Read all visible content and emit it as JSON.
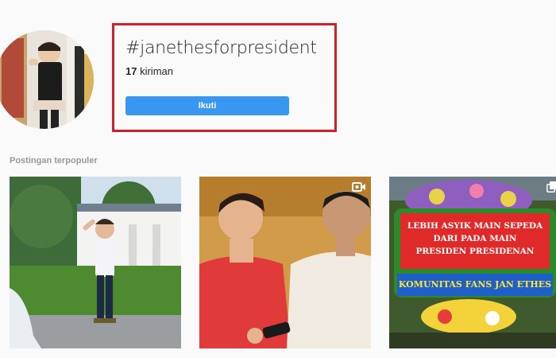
{
  "header": {
    "hashtag": "#janethesforpresident",
    "post_count": "17",
    "post_count_suffix": "kiriman",
    "follow_label": "Ikuti"
  },
  "section": {
    "top_posts_label": "Postingan terpopuler"
  },
  "posts": [
    {
      "kind": "photo",
      "icon": ""
    },
    {
      "kind": "video",
      "icon": "video-icon"
    },
    {
      "kind": "carousel",
      "icon": "multi-photo-icon",
      "banner_line1": "LEBIH ASYIK MAIN SEPEDA",
      "banner_line2": "DARI PADA MAIN",
      "banner_line3": "PRESIDEN PRESIDENAN",
      "banner_bottom": "KOMUNITAS FANS JAN ETHES"
    }
  ],
  "colors": {
    "follow_button": "#3897f0",
    "highlight_box": "#d0202e",
    "background": "#fafafa"
  }
}
